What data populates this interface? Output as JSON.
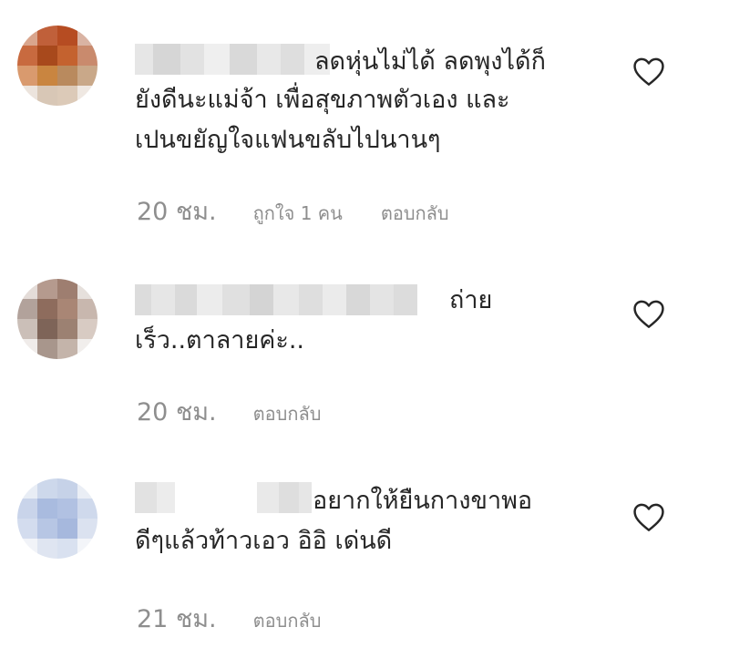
{
  "comments": [
    {
      "text_line1": "ลดหุ่นไม่ได้ ลดพุงได้ก็",
      "text_line2": "ยังดีนะแม่จ้า เพื่อสุขภาพตัวเอง และ",
      "text_line3": "เปนขยัญใจแฟนขลับไปนานๆ",
      "time": "20 ชม.",
      "likes": "ถูกใจ 1 คน",
      "reply": "ตอบกลับ",
      "heart_icon": "heart-outline-icon"
    },
    {
      "text_line1": "ถ่าย",
      "text_line2": "เร็ว..ตาลายค่ะ..",
      "time": "20 ชม.",
      "reply": "ตอบกลับ",
      "heart_icon": "heart-outline-icon"
    },
    {
      "text_line1": "อยากให้ยืนกางขาพอ",
      "text_line2": "ดีๆแล้วท้าวเอว อิอิ เด่นดี",
      "time": "21 ชม.",
      "reply": "ตอบกลับ",
      "heart_icon": "heart-outline-icon"
    }
  ],
  "colors": {
    "text": "#262626",
    "secondary": "#8e8e8e",
    "background": "#ffffff"
  }
}
